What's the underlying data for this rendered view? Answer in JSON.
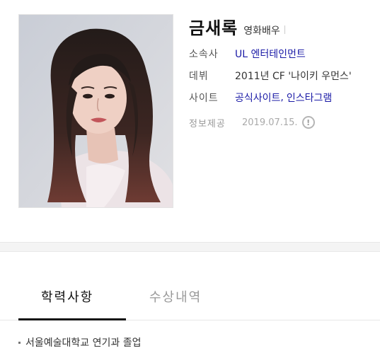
{
  "profile": {
    "name": "금새록",
    "occupation": "영화배우",
    "agency_label": "소속사",
    "agency_value": "UL 엔터테인먼트",
    "debut_label": "데뷔",
    "debut_value": "2011년 CF '나이키 우먼스'",
    "site_label": "사이트",
    "site_links": [
      "공식사이트",
      "인스타그램"
    ],
    "site_separator": ",",
    "source_label": "정보제공",
    "source_date": "2019.07.15.",
    "info_icon": "!"
  },
  "tabs": {
    "education": "학력사항",
    "awards": "수상내역",
    "active": "education"
  },
  "education": {
    "items": [
      "서울예술대학교 연기과 졸업"
    ]
  },
  "colors": {
    "link": "#1a1aa6",
    "muted": "#999999",
    "band": "#f4f4f4"
  },
  "icons": {
    "info": "exclamation-circle-icon"
  }
}
